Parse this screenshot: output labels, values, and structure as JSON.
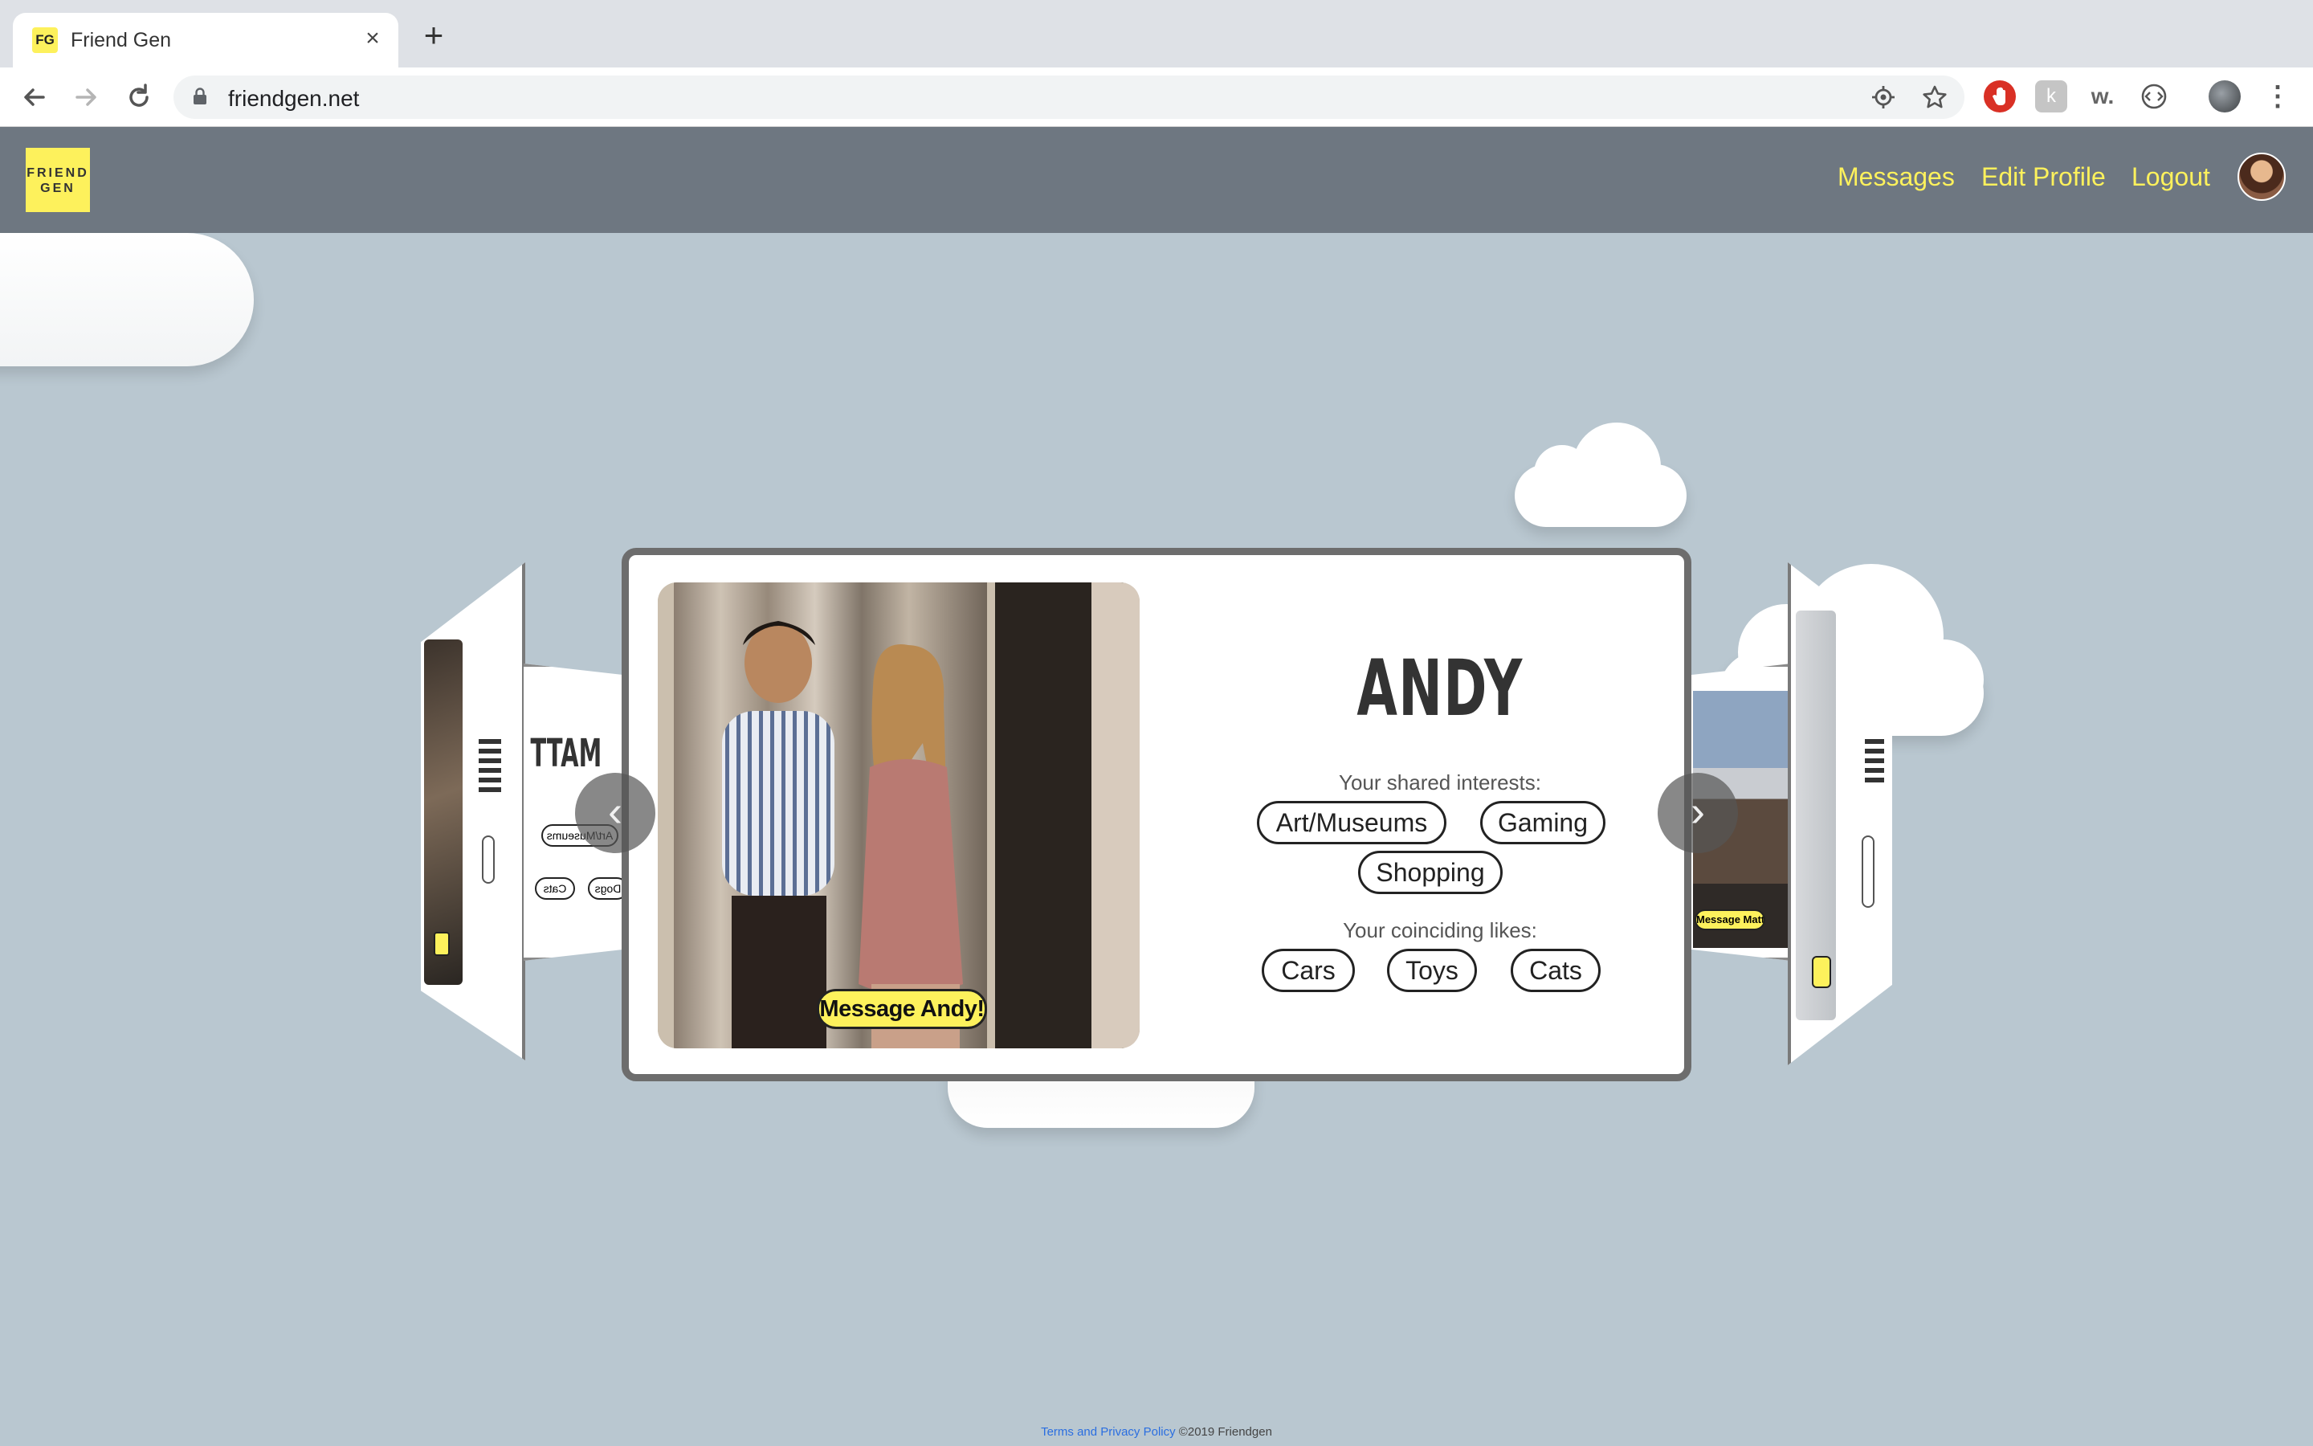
{
  "browser": {
    "tab_title": "Friend Gen",
    "tab_favicon_text": "FG",
    "url": "friendgen.net",
    "new_tab_symbol": "+",
    "close_symbol": "×"
  },
  "site": {
    "logo_line1": "FRIEND",
    "logo_line2": "GEN",
    "nav": {
      "messages": "Messages",
      "edit_profile": "Edit Profile",
      "logout": "Logout"
    }
  },
  "carousel": {
    "current": {
      "name": "ANDY",
      "message_button": "Message Andy!",
      "shared_interests_label": "Your shared interests:",
      "shared_interests": [
        "Art/Museums",
        "Gaming",
        "Shopping"
      ],
      "coinciding_likes_label": "Your coinciding likes:",
      "coinciding_likes": [
        "Cars",
        "Toys",
        "Cats"
      ]
    },
    "left_card": {
      "name": "MATT",
      "shared_interests": [
        "Art/Museums"
      ],
      "coinciding_likes": [
        "Cats",
        "Dogs"
      ]
    },
    "right_card": {
      "message_button": "Message Matt!"
    },
    "prev_arrow": "‹",
    "next_arrow": "›"
  },
  "footer": {
    "link": "Terms and Privacy Policy",
    "text": "©2019 Friendgen"
  },
  "colors": {
    "background": "#b9c7d0",
    "header": "#6e7781",
    "accent_yellow": "#fdf15c"
  }
}
